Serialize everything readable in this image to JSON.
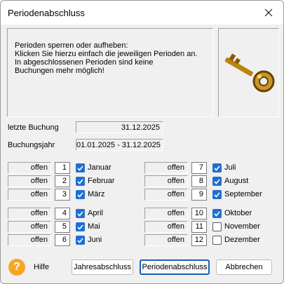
{
  "window": {
    "title": "Periodenabschluss"
  },
  "info": {
    "lines": [
      "Perioden sperren oder aufheben:",
      "Klicken Sie hierzu einfach die jeweiligen Perioden an.",
      "In abgeschlossenen Perioden sind keine",
      "Buchungen mehr möglich!"
    ]
  },
  "fields": {
    "last_booking_label": "letzte Buchung",
    "last_booking_value": "31.12.2025",
    "fiscal_year_label": "Buchungsjahr",
    "fiscal_year_value": "01.01.2025 - 31.12.2025"
  },
  "periods": [
    {
      "status": "offen",
      "number": "1",
      "month": "Januar",
      "checked": true
    },
    {
      "status": "offen",
      "number": "2",
      "month": "Februar",
      "checked": true
    },
    {
      "status": "offen",
      "number": "3",
      "month": "März",
      "checked": true
    },
    {
      "status": "offen",
      "number": "4",
      "month": "April",
      "checked": true
    },
    {
      "status": "offen",
      "number": "5",
      "month": "Mai",
      "checked": true
    },
    {
      "status": "offen",
      "number": "6",
      "month": "Juni",
      "checked": true
    },
    {
      "status": "offen",
      "number": "7",
      "month": "Juli",
      "checked": true
    },
    {
      "status": "offen",
      "number": "8",
      "month": "August",
      "checked": true
    },
    {
      "status": "offen",
      "number": "9",
      "month": "September",
      "checked": true
    },
    {
      "status": "offen",
      "number": "10",
      "month": "Oktober",
      "checked": true
    },
    {
      "status": "offen",
      "number": "11",
      "month": "November",
      "checked": false
    },
    {
      "status": "offen",
      "number": "12",
      "month": "Dezember",
      "checked": false
    }
  ],
  "footer": {
    "help_label": "Hilfe",
    "help_icon": "question-mark-icon",
    "year_end_button": "Jahresabschluss",
    "period_close_button": "Periodenabschluss",
    "cancel_button": "Abbrechen"
  },
  "colors": {
    "checkbox_accent": "#1f6fd1",
    "help_icon": "#f5a623",
    "default_button_border": "#1a5fb4"
  }
}
